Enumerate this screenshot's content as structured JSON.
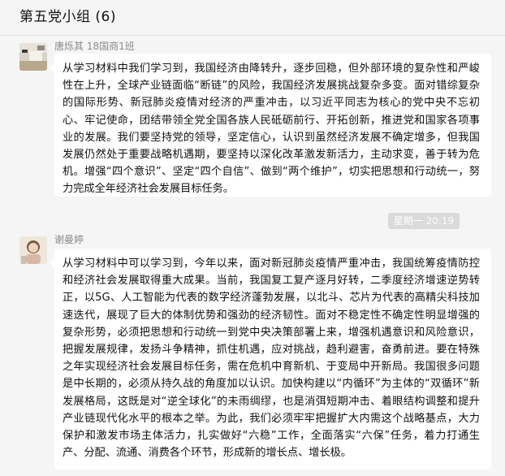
{
  "header": {
    "title": "第五党小组 (6)"
  },
  "messages": [
    {
      "sender": "唐烁其 18国商1班",
      "text": "从学习材料中我们学习到，我国经济由降转升，逐步回稳，但外部环境的复杂性和严峻性在上升，全球产业链面临“断链”的风险，我国经济发展挑战复杂多变。面对错综复杂的国际形势、新冠肺炎疫情对经济的严重冲击，以习近平同志为核心的党中央不忘初心、牢记使命，团结带领全党全国各族人民砥砺前行、开拓创新，推进党和国家各项事业的发展。我们要坚持党的领导，坚定信心，认识到虽然经济发展不确定增多，但我国发展仍然处于重要战略机遇期，要坚持以深化改革激发新活力，主动求变，善于转为危机。增强“四个意识”、坚定“四个自信”、做到“两个维护”，切实把思想和行动统一，努力完成全年经济社会发展目标任务。"
    },
    {
      "sender": "谢曼婷",
      "text": "从学习材料中可以学习到，今年以来，面对新冠肺炎疫情严重冲击，我国统筹疫情防控和经济社会发展取得重大成果。当前，我国复工复产逐月好转，二季度经济增速逆势转正，以5G、人工智能为代表的数字经济蓬勃发展，以北斗、芯片为代表的高精尖科技加速迭代，展现了巨大的体制优势和强劲的经济韧性。面对不稳定性不确定性明显增强的复杂形势，必须把思想和行动统一到党中央决策部署上来，增强机遇意识和风险意识，把握发展规律，发扬斗争精神，抓住机遇，应对挑战，趋利避害，奋勇前进。要在特殊之年实现经济社会发展目标任务，需在危机中育新机、于变局中开新局。我国很多问题是中长期的，必须从持久战的角度加以认识。加快构建以“内循环”为主体的“双循环”新发展格局，这既是对“逆全球化”的未雨绸缪，也是消弭短期冲击、着眼结构调整和提升产业链现代化水平的根本之举。为此，我们必须牢牢把握扩大内需这个战略基点，大力保护和激发市场主体活力，扎实做好“六稳”工作，全面落实“六保”任务，着力打通生产、分配、流通、消费各个环节，形成新的增长点、增长极。"
    }
  ],
  "timestamp": "星期一 20:19"
}
